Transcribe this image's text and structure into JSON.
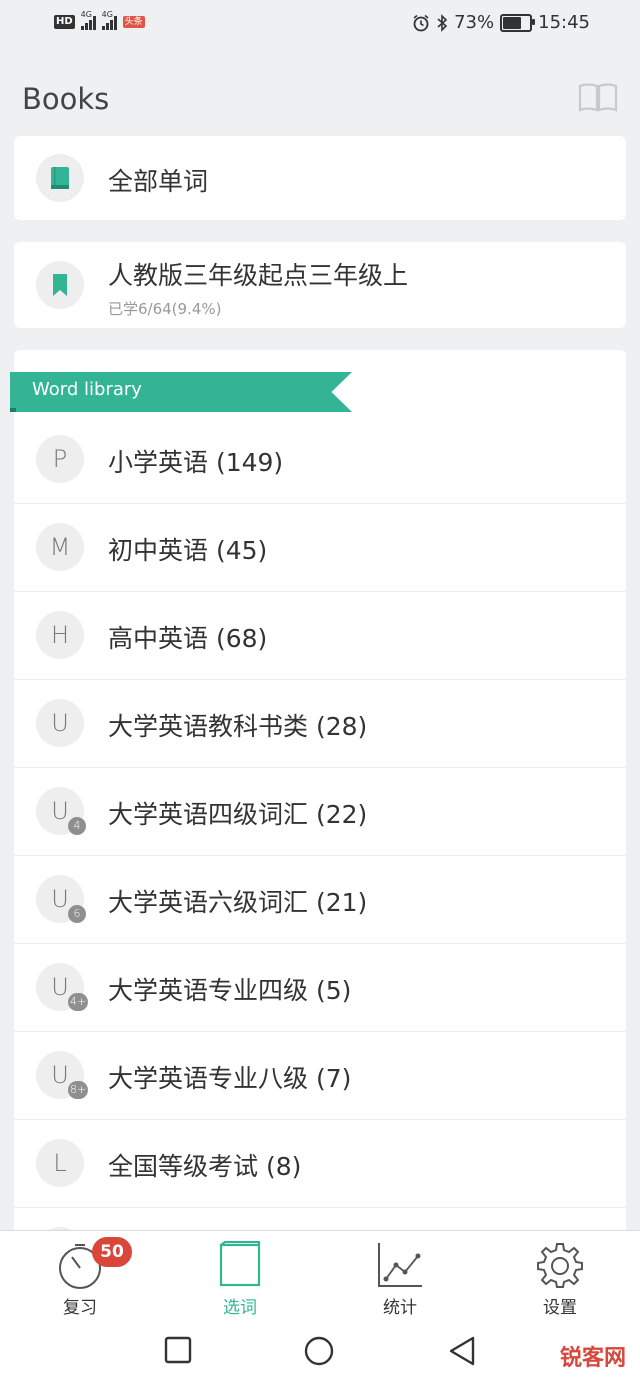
{
  "status_bar": {
    "left_badge": "HD",
    "signal1": "4G",
    "signal2": "4G",
    "red_badge": "头条",
    "battery_percent": "73%",
    "battery_level": 0.73,
    "time": "15:45"
  },
  "header": {
    "title": "Books"
  },
  "all_words": {
    "label": "全部单词"
  },
  "current_book": {
    "label": "人教版三年级起点三年级上",
    "progress": "已学6/64(9.4%)"
  },
  "library": {
    "ribbon": "Word library",
    "items": [
      {
        "letter": "P",
        "sub": "",
        "label": "小学英语 (149)"
      },
      {
        "letter": "M",
        "sub": "",
        "label": "初中英语 (45)"
      },
      {
        "letter": "H",
        "sub": "",
        "label": "高中英语 (68)"
      },
      {
        "letter": "U",
        "sub": "",
        "label": "大学英语教科书类 (28)"
      },
      {
        "letter": "U",
        "sub": "4",
        "label": "大学英语四级词汇 (22)"
      },
      {
        "letter": "U",
        "sub": "6",
        "label": "大学英语六级词汇 (21)"
      },
      {
        "letter": "U",
        "sub": "4+",
        "label": "大学英语专业四级 (5)"
      },
      {
        "letter": "U",
        "sub": "8+",
        "label": "大学英语专业八级 (7)"
      },
      {
        "letter": "L",
        "sub": "",
        "label": "全国等级考试 (8)"
      }
    ]
  },
  "tabs": {
    "review": {
      "label": "复习",
      "badge": "50"
    },
    "select": {
      "label": "选词"
    },
    "stats": {
      "label": "统计"
    },
    "settings": {
      "label": "设置"
    }
  },
  "watermark": {
    "text": "锐客网"
  },
  "colors": {
    "accent": "#33b495",
    "badge": "#d9463a",
    "background": "#eef0f2"
  }
}
